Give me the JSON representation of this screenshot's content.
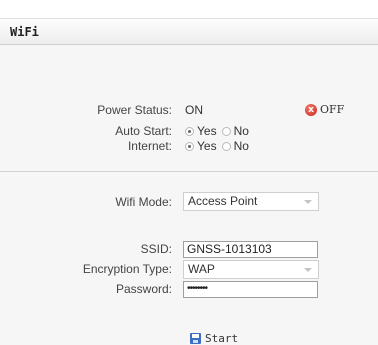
{
  "window": {
    "title": "WiFi"
  },
  "power": {
    "label": "Power Status:",
    "value": "ON",
    "off_button": "OFF",
    "off_icon": "x"
  },
  "auto_start": {
    "label": "Auto Start:",
    "options": [
      "Yes",
      "No"
    ],
    "selected": "Yes"
  },
  "internet": {
    "label": "Internet:",
    "options": [
      "Yes",
      "No"
    ],
    "selected": "Yes"
  },
  "wifi_mode": {
    "label": "Wifi Mode:",
    "value": "Access Point"
  },
  "ssid": {
    "label": "SSID:",
    "value": "GNSS-1013103"
  },
  "encryption": {
    "label": "Encryption Type:",
    "value": "WAP"
  },
  "password": {
    "label": "Password:",
    "value": "••••••••"
  },
  "start_button": {
    "label": "Start"
  },
  "colors": {
    "off_icon": "#d23a2c",
    "panel_bg": "#f6f6f6",
    "save_icon": "#3b6fc4"
  }
}
